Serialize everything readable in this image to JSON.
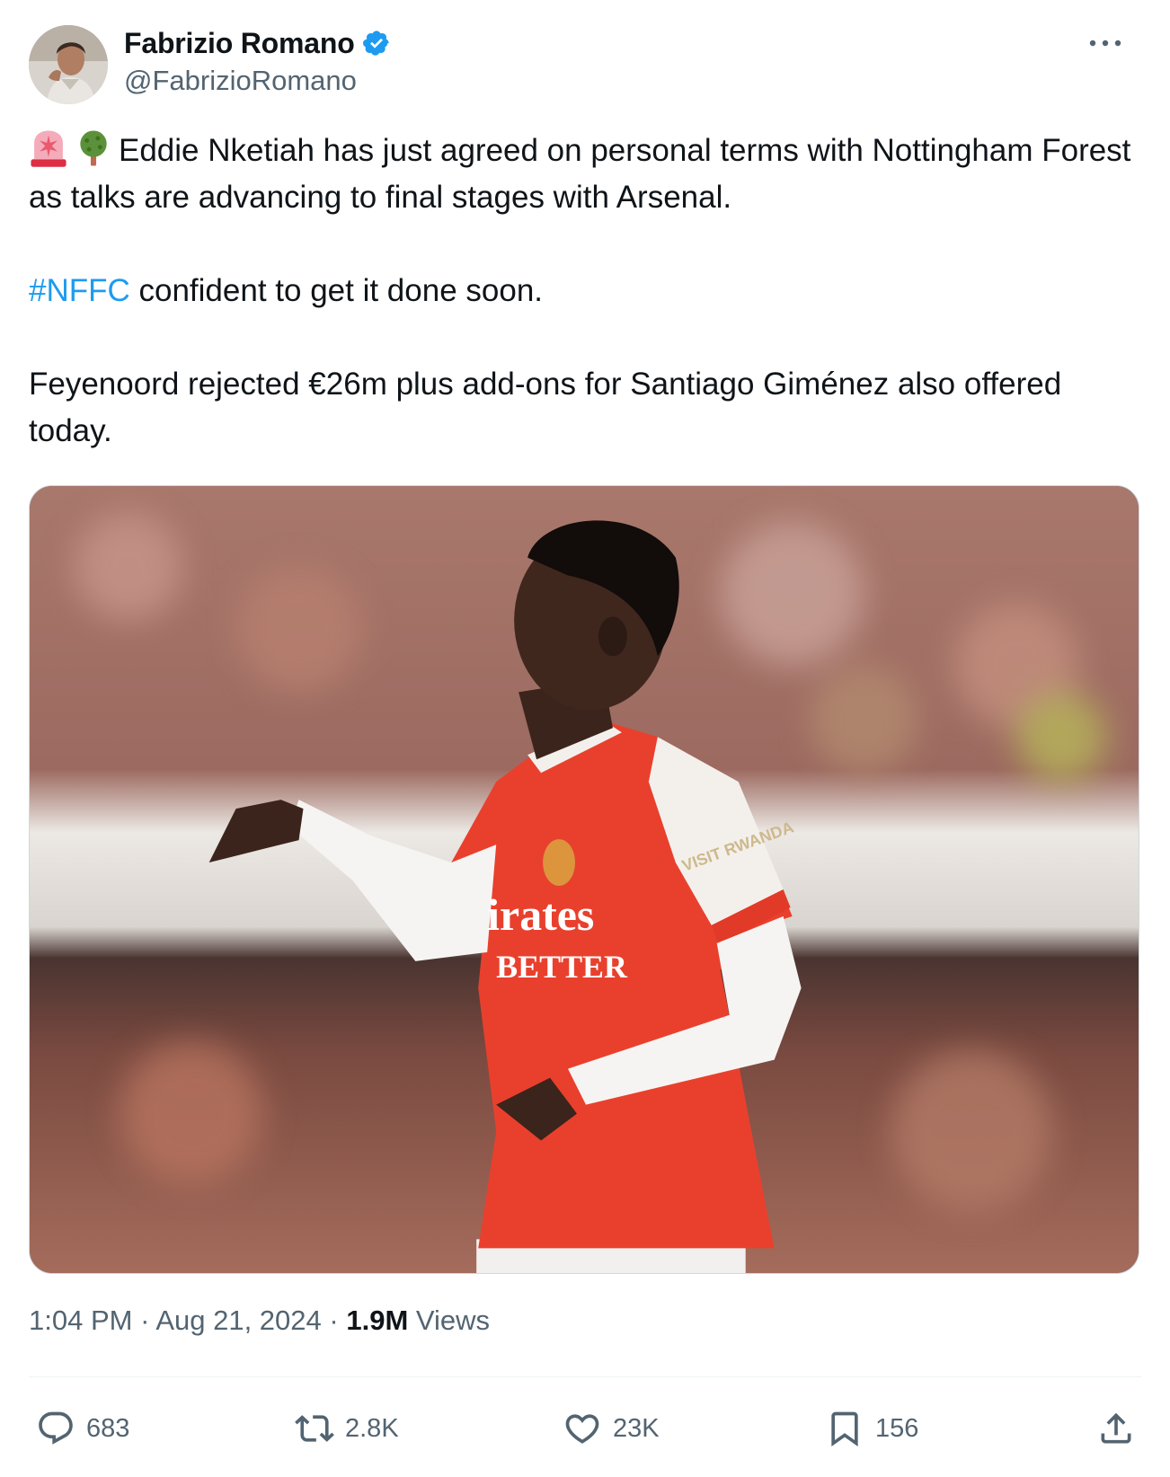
{
  "author": {
    "display_name": "Fabrizio Romano",
    "handle": "@FabrizioRomano",
    "verified": true,
    "avatar_icon": "profile-photo"
  },
  "tweet": {
    "emojis": [
      "rotating-light-emoji",
      "deciduous-tree-emoji"
    ],
    "line1": "Eddie Nketiah has just agreed on personal terms with Nottingham Forest as talks are advancing to final stages with Arsenal.",
    "hashtag": "#NFFC",
    "line2_rest": " confident to get it done soon.",
    "line3": "Feyenoord rejected €26m plus add-ons for Santiago Giménez also offered today."
  },
  "media": {
    "kind": "photo",
    "description_icon": "football-player-photo",
    "jersey_text_1": "irates",
    "jersey_text_2": "BETTER",
    "sleeve_text": "VISIT RWANDA"
  },
  "meta": {
    "time": "1:04 PM",
    "separator": "·",
    "date": "Aug 21, 2024",
    "views_count": "1.9M",
    "views_label": "Views"
  },
  "actions": {
    "reply_count": "683",
    "retweet_count": "2.8K",
    "like_count": "23K",
    "bookmark_count": "156"
  },
  "colors": {
    "accent": "#1d9bf0",
    "secondary_text": "#536471",
    "primary_text": "#0f1419"
  }
}
